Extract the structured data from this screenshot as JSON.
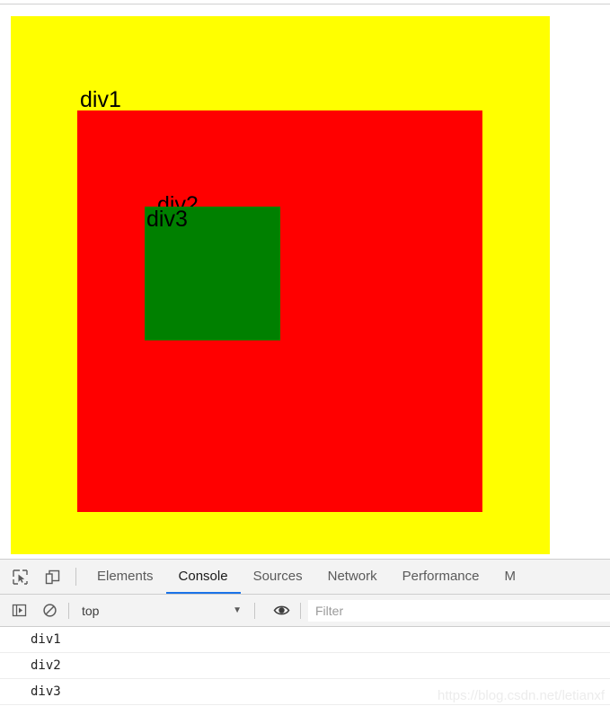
{
  "page": {
    "boxes": {
      "div1": {
        "label": "div1",
        "color": "#ffff00"
      },
      "div2": {
        "label": "div2",
        "color": "#ff0000"
      },
      "div3": {
        "label": "div3",
        "color": "#008000"
      }
    }
  },
  "devtools": {
    "icons": {
      "inspect": "inspect-element-icon",
      "device": "device-toolbar-icon",
      "sidebar": "console-sidebar-icon",
      "clear": "clear-console-icon",
      "eye": "create-live-expression-icon",
      "caret": "chevron-down-icon"
    },
    "tabs": [
      {
        "label": "Elements",
        "active": false
      },
      {
        "label": "Console",
        "active": true
      },
      {
        "label": "Sources",
        "active": false
      },
      {
        "label": "Network",
        "active": false
      },
      {
        "label": "Performance",
        "active": false
      },
      {
        "label": "M",
        "active": false
      }
    ],
    "toolbar": {
      "context": "top",
      "caret": "▼",
      "filter_placeholder": "Filter",
      "filter_value": ""
    },
    "console": {
      "messages": [
        {
          "text": "div1"
        },
        {
          "text": "div2"
        },
        {
          "text": "div3"
        }
      ]
    },
    "accent_color": "#1a73e8"
  },
  "watermark": {
    "text": "https://blog.csdn.net/letianxf"
  }
}
